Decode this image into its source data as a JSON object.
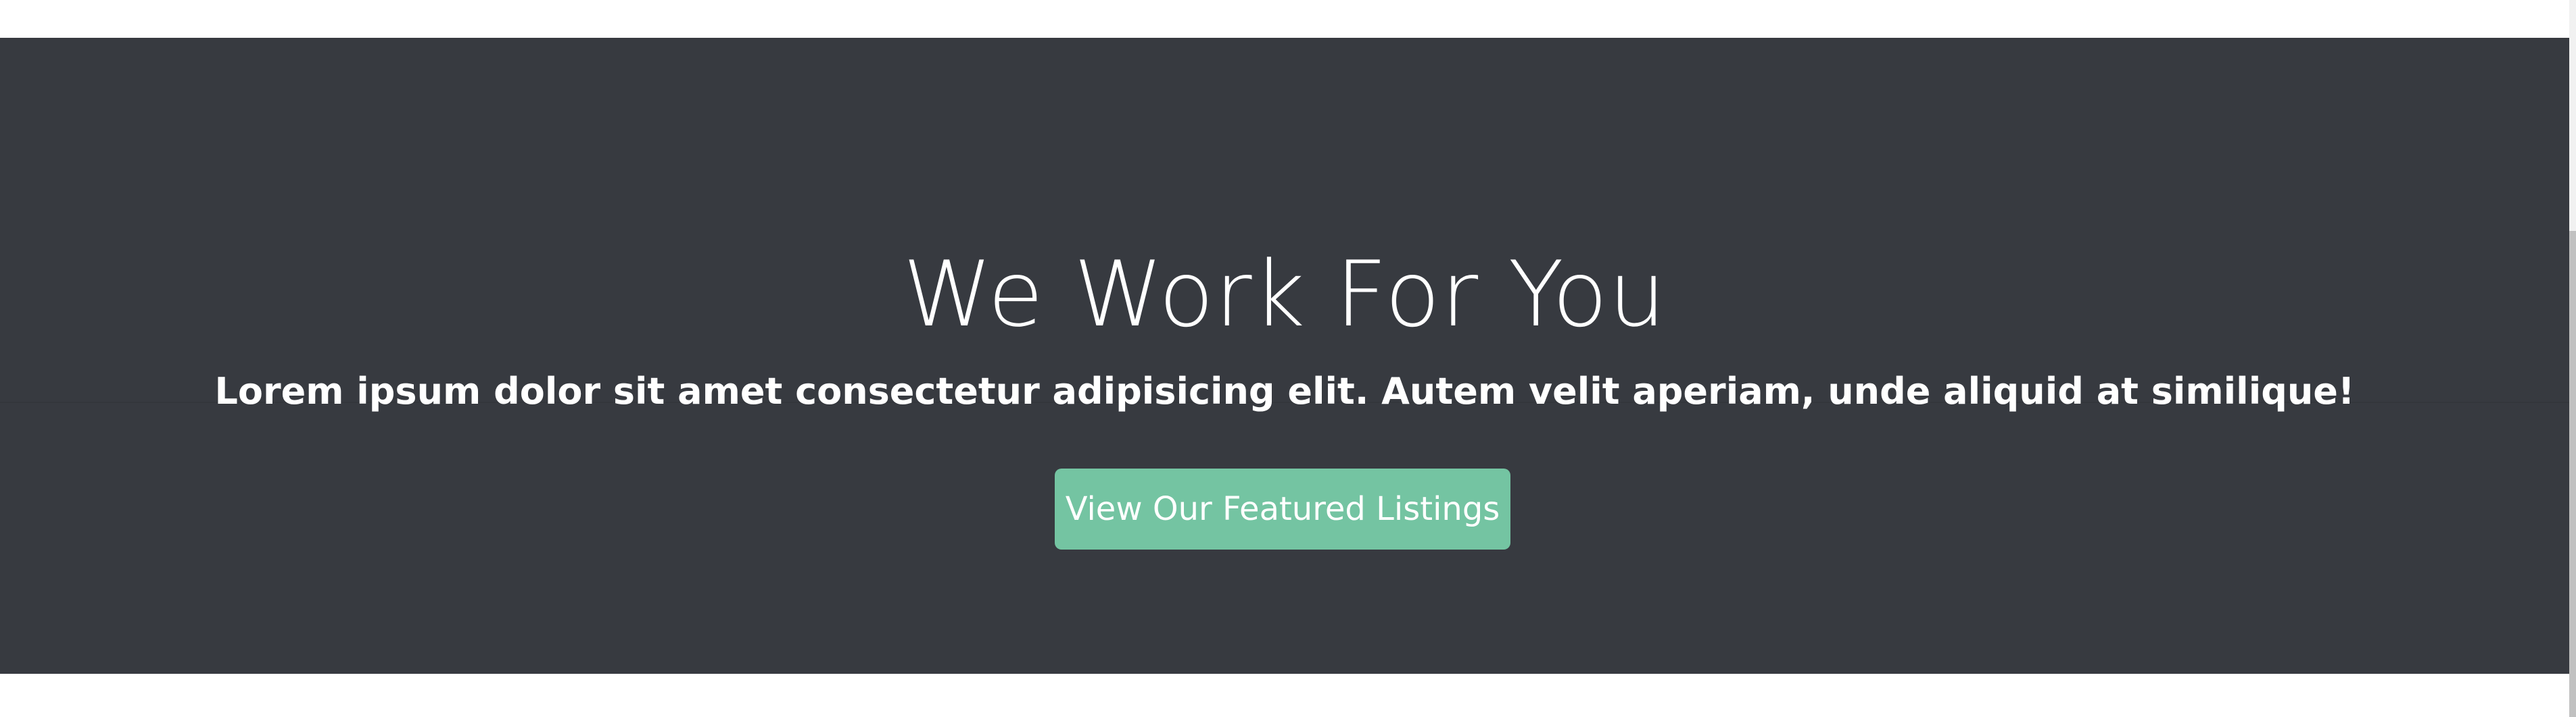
{
  "hero": {
    "title": "We Work For You",
    "lead": "Lorem ipsum dolor sit amet consectetur adipisicing elit. Autem velit aperiam, unde aliquid at similique!",
    "button_label": "View Our Featured Listings",
    "background_color": "#373a40",
    "button_color": "#74c4a2"
  }
}
